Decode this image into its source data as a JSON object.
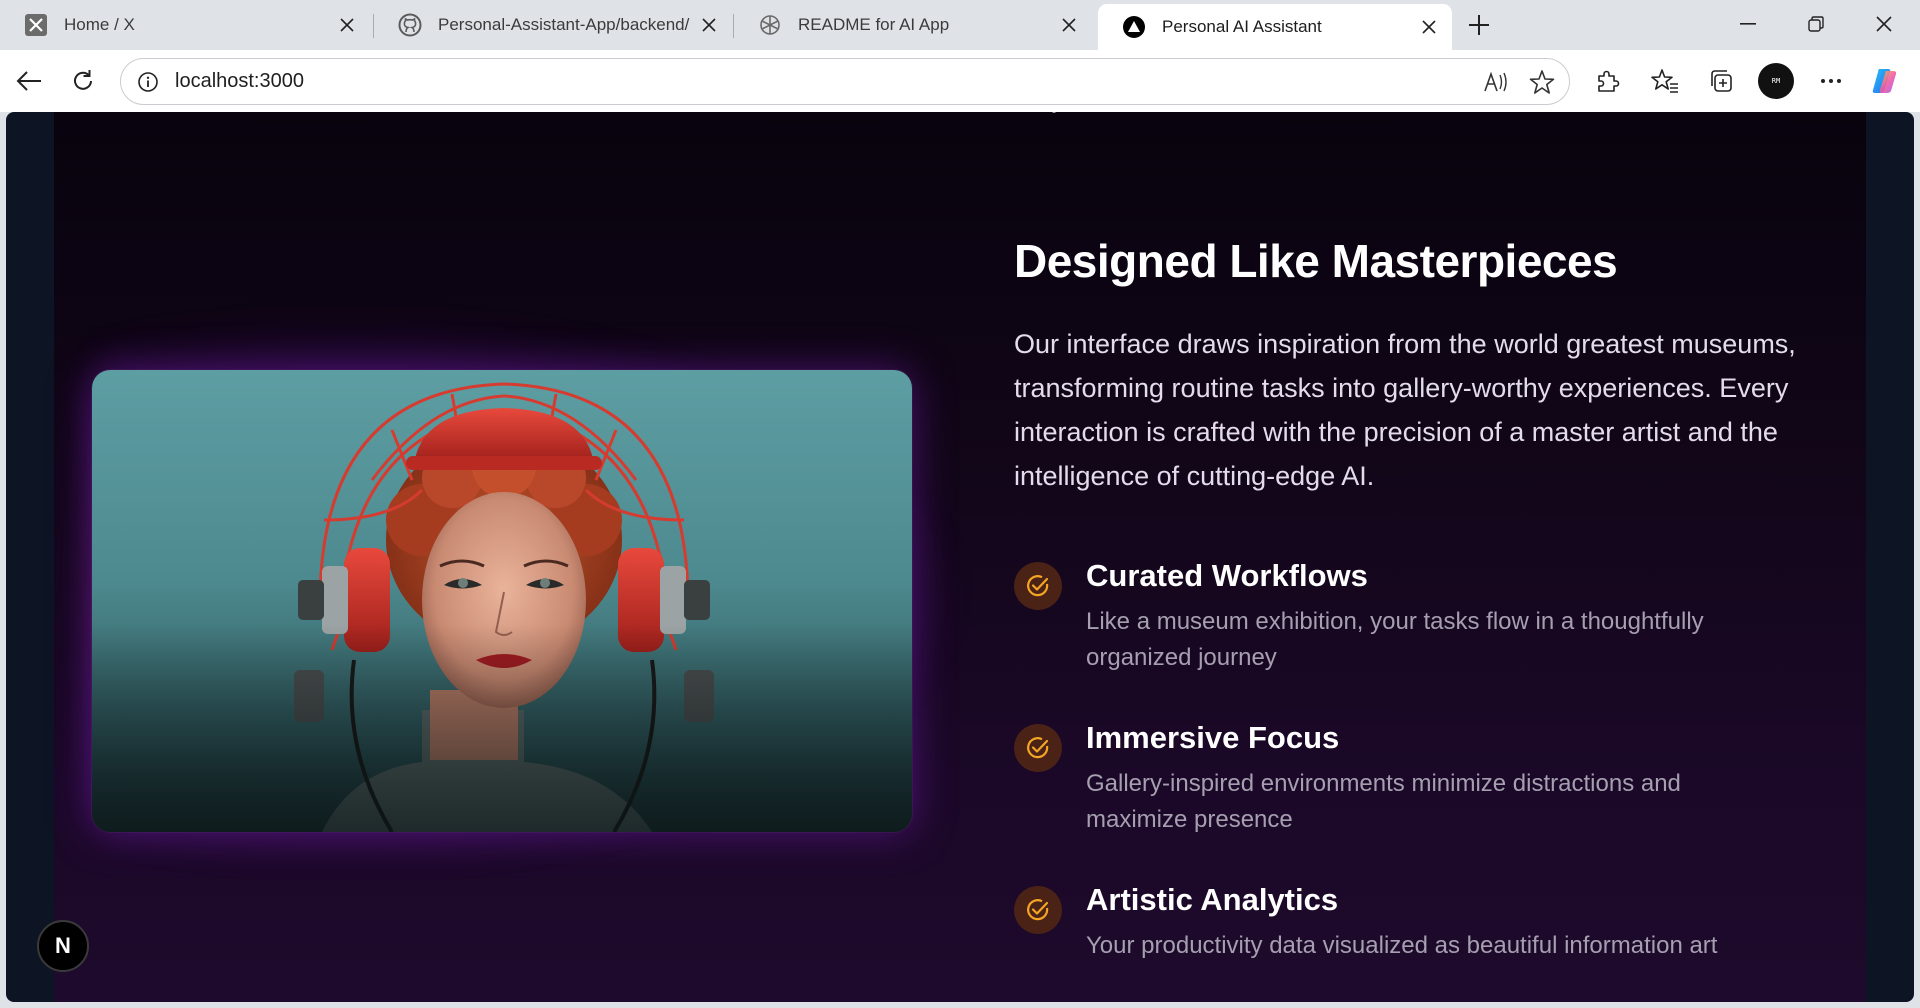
{
  "browser": {
    "tabs": [
      {
        "title": "Home / X",
        "icon": "x-logo-icon",
        "active": false
      },
      {
        "title": "Personal-Assistant-App/backend/",
        "icon": "github-icon",
        "active": false
      },
      {
        "title": "README for AI App",
        "icon": "openai-icon",
        "active": false
      },
      {
        "title": "Personal AI Assistant",
        "icon": "triangle-logo-icon",
        "active": true
      }
    ],
    "url": "localhost:3000",
    "profile_text": "RM"
  },
  "section": {
    "heading": "Designed Like Masterpieces",
    "intro": "Our interface draws inspiration from the world greatest museums, transforming routine tasks into gallery-worthy experiences. Every interaction is crafted with the precision of a master artist and the intelligence of cutting-edge AI.",
    "image_alt": "Portrait of a woman with red hair wearing a red retro-futuristic headset",
    "features": [
      {
        "title": "Curated Workflows",
        "description": "Like a museum exhibition, your tasks flow in a thoughtfully organized journey"
      },
      {
        "title": "Immersive Focus",
        "description": "Gallery-inspired environments minimize distractions and maximize presence"
      },
      {
        "title": "Artistic Analytics",
        "description": "Your productivity data visualized as beautiful information art"
      }
    ]
  },
  "dev_badge": "N",
  "colors": {
    "accent": "#f5a524",
    "badge_bg": "#4a2216",
    "page_bg_top": "#08030d",
    "page_bg_bottom": "#1e0a2c"
  }
}
